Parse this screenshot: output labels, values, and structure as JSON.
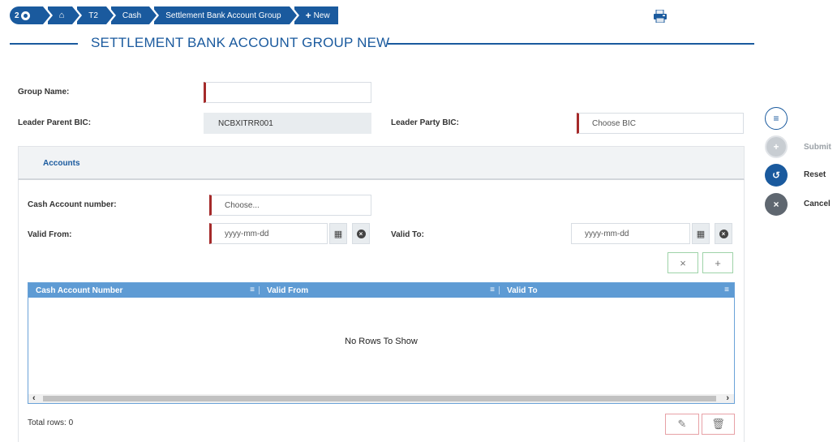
{
  "breadcrumb": {
    "count": "2",
    "items": [
      "T2",
      "Cash",
      "Settlement Bank Account Group"
    ],
    "new_label": "New"
  },
  "page_title": "SETTLEMENT BANK ACCOUNT GROUP NEW",
  "form": {
    "group_name_label": "Group Name:",
    "group_name_value": "",
    "leader_parent_bic_label": "Leader Parent BIC:",
    "leader_parent_bic_value": "NCBXITRR001",
    "leader_party_bic_label": "Leader Party BIC:",
    "leader_party_bic_placeholder": "Choose BIC"
  },
  "accounts": {
    "tab_label": "Accounts",
    "cash_account_label": "Cash Account number:",
    "cash_account_placeholder": "Choose...",
    "valid_from_label": "Valid From:",
    "valid_from_placeholder": "yyyy-mm-dd",
    "valid_to_label": "Valid To:",
    "valid_to_placeholder": "yyyy-mm-dd"
  },
  "grid": {
    "columns": [
      "Cash Account Number",
      "Valid From",
      "Valid To"
    ],
    "empty_message": "No Rows To Show",
    "total_rows": "Total rows: 0"
  },
  "actions": {
    "submit": "Submit",
    "reset": "Reset",
    "cancel": "Cancel"
  },
  "colors": {
    "primary": "#1a5a9e",
    "mandatory_marker": "#a52a2a",
    "grid_header": "#5e9bd4"
  },
  "icons": [
    "eye-icon",
    "home-icon",
    "plus-icon",
    "print-icon",
    "calendar-icon",
    "clear-icon",
    "close-icon",
    "add-icon",
    "edit-icon",
    "delete-icon",
    "menu-icon",
    "reset-icon",
    "cancel-icon",
    "scroll-left-icon",
    "scroll-right-icon"
  ]
}
